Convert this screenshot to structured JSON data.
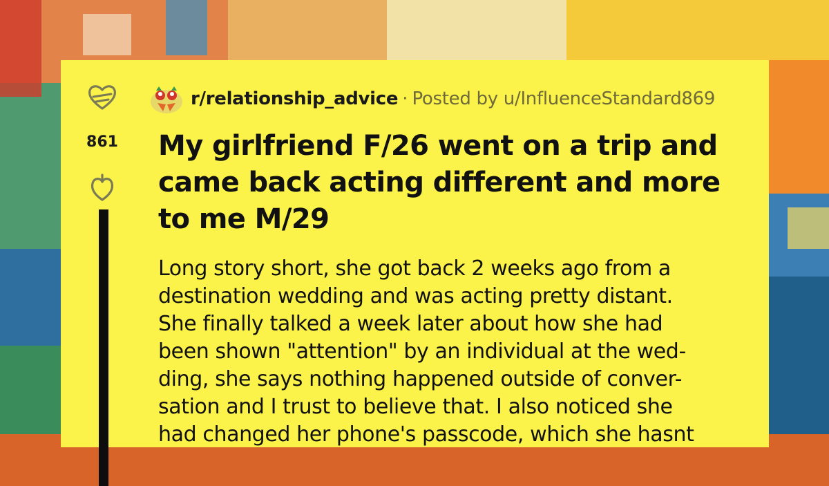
{
  "post": {
    "subreddit": "r/relationship_advice",
    "separator": "·",
    "posted_by": "Posted by u/InfluenceStandard869",
    "score": "861",
    "title": "My girlfriend F/26 went on a trip and came back acting different and more to me M/29",
    "body_lines": [
      "Long story short, she got back 2 weeks ago from a",
      "destination wedding and was acting pretty distant.",
      "She finally talked a week later about how she had",
      "been shown \"attention\" by an individual at the wed-",
      "ding, she says nothing happened outside of conver-",
      "sation and I trust to believe that. I also noticed she",
      "had changed her phone's passcode, which she hasnt"
    ]
  },
  "icons": {
    "upvote": "heart-upvote-icon",
    "downvote": "heart-downvote-icon",
    "subreddit": "rooster-subreddit-icon"
  },
  "colors": {
    "card_bg": "#fbf24a",
    "text": "#111111",
    "meta_text": "#6e6a3a",
    "thread_line": "#0d0d0d"
  }
}
